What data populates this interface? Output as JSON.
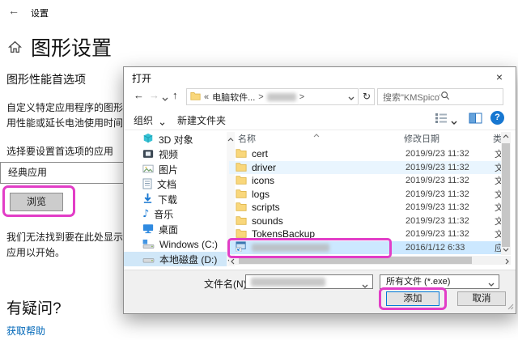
{
  "settings": {
    "window_title": "设置",
    "page_title": "图形设置",
    "section_title": "图形性能首选项",
    "description_line1": "自定义特定应用程序的图形",
    "description_line2": "用性能或延长电池使用时间",
    "choose_app_label": "选择要设置首选项的应用",
    "app_type_value": "经典应用",
    "browse_button": "浏览",
    "empty_text_line1": "我们无法找到要在此处显示",
    "empty_text_line2": "应用以开始。",
    "question_heading": "有疑问?",
    "help_link": "获取帮助"
  },
  "dialog": {
    "title": "打开",
    "close_button": "×",
    "nav": {
      "back": "←",
      "forward": "→",
      "up": "↑",
      "refresh": "↻"
    },
    "breadcrumb": {
      "collapsed": "«",
      "segment": "电脑软件...",
      "sep1": ">",
      "sep2": ">"
    },
    "search_text": "搜索\"KMSpico\"",
    "toolbar": {
      "organize": "组织",
      "new_folder": "新建文件夹"
    },
    "sidebar_items": [
      {
        "label": "3D 对象"
      },
      {
        "label": "视频"
      },
      {
        "label": "图片"
      },
      {
        "label": "文档"
      },
      {
        "label": "下载"
      },
      {
        "label": "音乐"
      },
      {
        "label": "桌面"
      },
      {
        "label": "Windows (C:)"
      },
      {
        "label": "本地磁盘 (D:)"
      }
    ],
    "columns": {
      "name": "名称",
      "date_modified": "修改日期",
      "type": "类"
    },
    "files": [
      {
        "name": "cert",
        "date": "2019/9/23 11:32",
        "type": "文"
      },
      {
        "name": "driver",
        "date": "2019/9/23 11:32",
        "type": "文"
      },
      {
        "name": "icons",
        "date": "2019/9/23 11:32",
        "type": "文"
      },
      {
        "name": "logs",
        "date": "2019/9/23 11:32",
        "type": "文"
      },
      {
        "name": "scripts",
        "date": "2019/9/23 11:32",
        "type": "文"
      },
      {
        "name": "sounds",
        "date": "2019/9/23 11:32",
        "type": "文"
      },
      {
        "name": "TokensBackup",
        "date": "2019/9/23 11:32",
        "type": "文"
      },
      {
        "name": "",
        "date": "2016/1/12 6:33",
        "type": "应",
        "redacted": true,
        "selected": true
      }
    ],
    "filename_label": "文件名(N):",
    "filename_value_redacted": true,
    "filetype_value": "所有文件 (*.exe)",
    "add_button": "添加",
    "cancel_button": "取消"
  },
  "colors": {
    "highlight_box": "#e23dc7",
    "selection_blue": "#cce8ff",
    "hover_blue": "#e9f5fe",
    "accent_blue": "#0078d7",
    "link_blue": "#0067b8",
    "folder_yellow": "#f9d77b"
  }
}
